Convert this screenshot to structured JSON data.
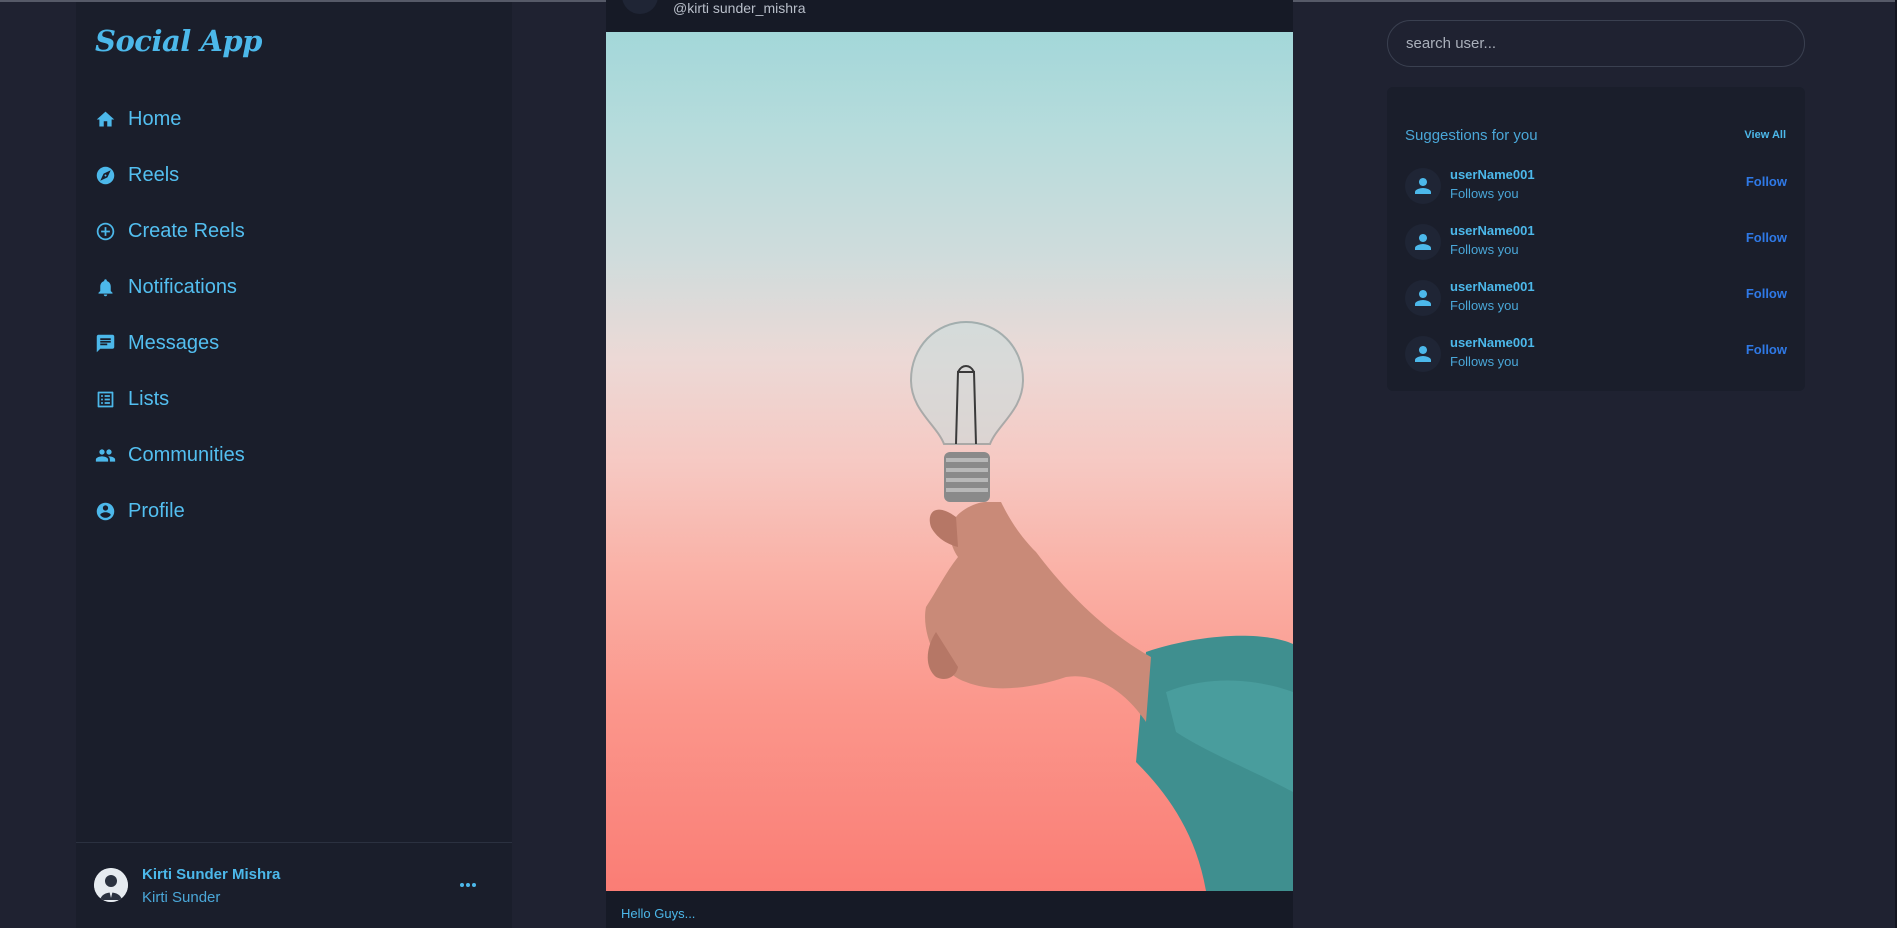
{
  "app": {
    "logo": "Social App"
  },
  "nav": {
    "items": [
      {
        "label": "Home",
        "icon": "home-icon"
      },
      {
        "label": "Reels",
        "icon": "compass-icon"
      },
      {
        "label": "Create Reels",
        "icon": "add-circle-icon"
      },
      {
        "label": "Notifications",
        "icon": "bell-icon"
      },
      {
        "label": "Messages",
        "icon": "message-icon"
      },
      {
        "label": "Lists",
        "icon": "list-icon"
      },
      {
        "label": "Communities",
        "icon": "people-icon"
      },
      {
        "label": "Profile",
        "icon": "account-circle-icon"
      }
    ]
  },
  "current_user": {
    "name": "Kirti Sunder Mishra",
    "handle": "Kirti Sunder"
  },
  "post": {
    "handle": "@kirti sunder_mishra",
    "image_alt": "hand holding light bulb against pastel sky",
    "caption": "Hello Guys..."
  },
  "search": {
    "placeholder": "search user..."
  },
  "suggestions": {
    "title": "Suggestions for you",
    "view_all": "View All",
    "users": [
      {
        "name": "userName001",
        "subtitle": "Follows you",
        "action": "Follow"
      },
      {
        "name": "userName001",
        "subtitle": "Follows you",
        "action": "Follow"
      },
      {
        "name": "userName001",
        "subtitle": "Follows you",
        "action": "Follow"
      },
      {
        "name": "userName001",
        "subtitle": "Follows you",
        "action": "Follow"
      }
    ]
  },
  "colors": {
    "background": "#1f2231",
    "panel": "#1a1e2b",
    "accent": "#4cb8ea",
    "follow": "#2f79e6"
  }
}
